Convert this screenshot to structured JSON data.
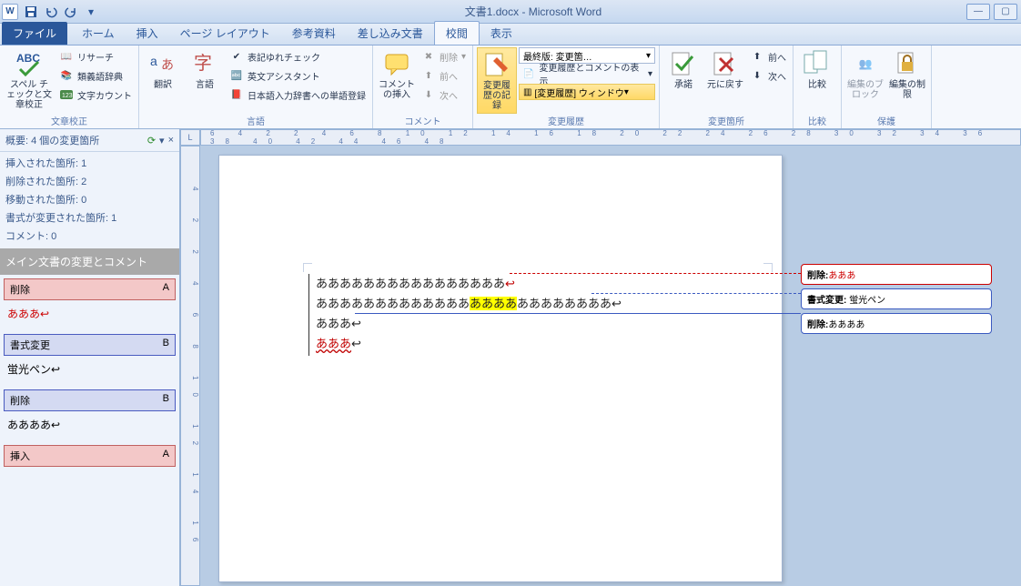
{
  "title": "文書1.docx - Microsoft Word",
  "tabs": {
    "file": "ファイル",
    "home": "ホーム",
    "insert": "挿入",
    "layout": "ページ レイアウト",
    "ref": "参考資料",
    "mail": "差し込み文書",
    "review": "校閲",
    "view": "表示"
  },
  "ribbon": {
    "proof": {
      "spell": "スペル チェックと文章校正",
      "research": "リサーチ",
      "thesaurus": "類義語辞典",
      "wordcount": "文字カウント",
      "label": "文章校正"
    },
    "lang": {
      "translate": "翻訳",
      "language": "言語",
      "hyoki": "表記ゆれチェック",
      "eigo": "英文アシスタント",
      "nihongo": "日本語入力辞書への単語登録",
      "label": "言語"
    },
    "comment": {
      "new": "コメントの挿入",
      "del": "削除",
      "prev": "前へ",
      "next": "次へ",
      "label": "コメント"
    },
    "track": {
      "track": "変更履歴の記録",
      "display": "最終版: 変更箇…",
      "show": "変更履歴とコメントの表示",
      "pane": "[変更履歴] ウィンドウ",
      "label": "変更履歴"
    },
    "accept": {
      "accept": "承諾",
      "reject": "元に戻す",
      "prev": "前へ",
      "next": "次へ",
      "label": "変更箇所"
    },
    "compare": {
      "compare": "比較",
      "label": "比較"
    },
    "protect": {
      "block": "編集のブロック",
      "restrict": "編集の制限",
      "label": "保護"
    }
  },
  "revpane": {
    "header": "概要: 4 個の変更箇所",
    "ins": "挿入された箇所: 1",
    "del": "削除された箇所: 2",
    "mov": "移動された箇所: 0",
    "fmt": "書式が変更された箇所: 1",
    "cmt": "コメント: 0",
    "section": "メイン文書の変更とコメント",
    "i1h": "削除",
    "i1a": "A",
    "i1b": "あああ↩",
    "i2h": "書式変更",
    "i2a": "B",
    "i2b": "蛍光ペン↩",
    "i3h": "削除",
    "i3a": "B",
    "i3b": "ああああ↩",
    "i4h": "挿入",
    "i4a": "A"
  },
  "doc": {
    "l1": "ああああああああああああああああ",
    "l1d": "↩",
    "l2a": "あああああああああああああ",
    "l2b": "ああああ",
    "l2c": "ああああああああ↩",
    "l3": "あああ↩",
    "l4": "あああ",
    "l4m": "↩"
  },
  "balloons": {
    "b1k": "削除:",
    "b1v": "あああ",
    "b2k": "書式変更:",
    "b2v": "蛍光ペン",
    "b3k": "削除:",
    "b3v": "ああああ"
  },
  "ruler_h": "6 4 2 2 4 6 8 10 12 14 16 18 20 22 24 26 28 30 32 34 36 38 40 42 44 46 48",
  "ruler_v": "4 2 2 4 6 8 10 12 14 16"
}
